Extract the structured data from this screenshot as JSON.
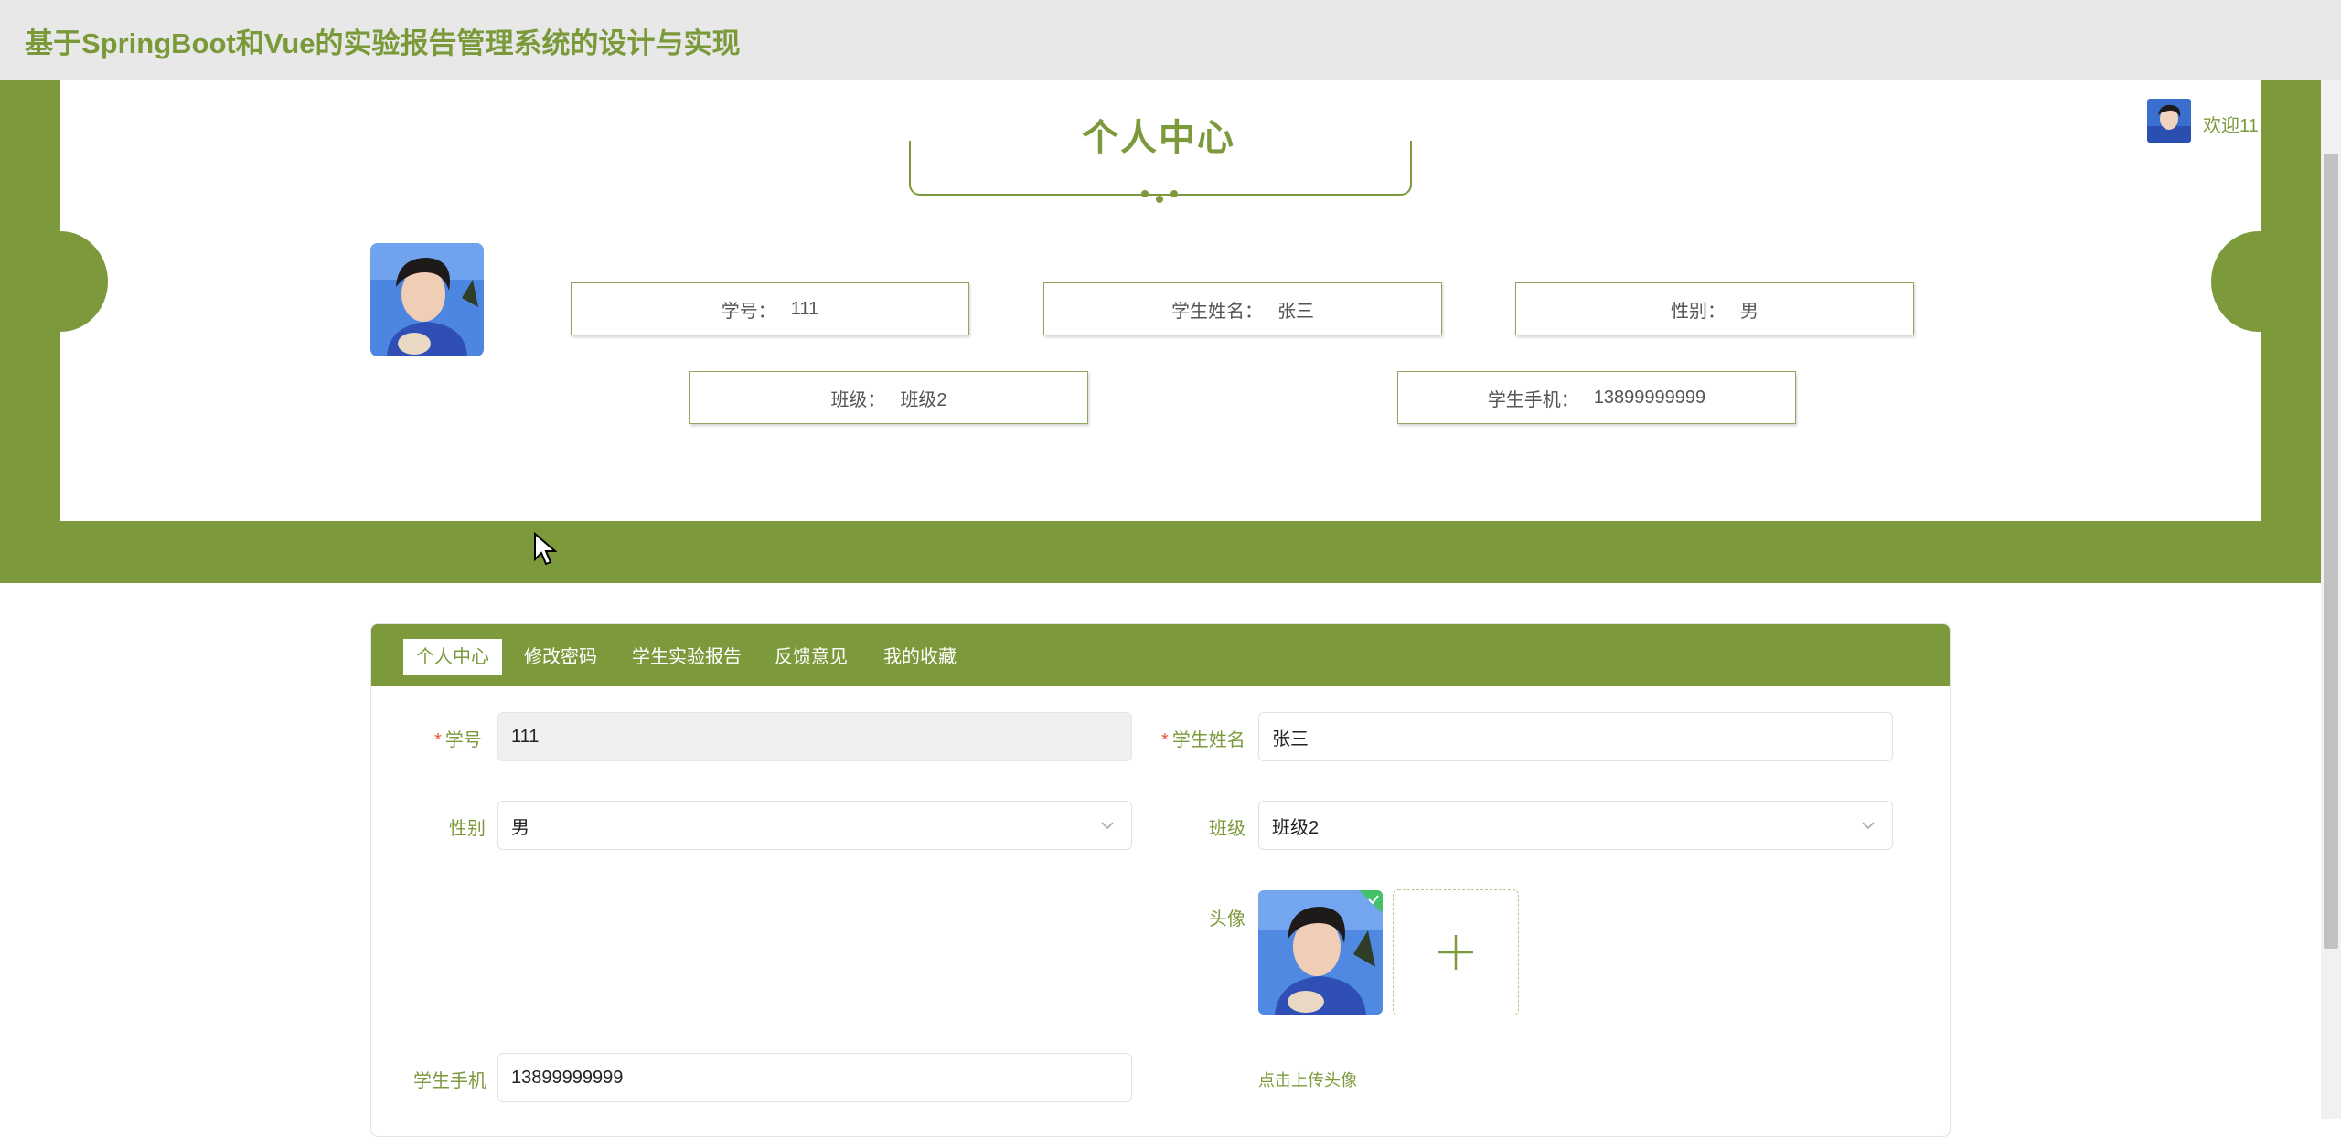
{
  "header": {
    "title": "基于SpringBoot和Vue的实验报告管理系统的设计与实现"
  },
  "user": {
    "welcome": "欢迎11"
  },
  "profile": {
    "heading": "个人中心",
    "fields": [
      {
        "label": "学号：",
        "value": "111"
      },
      {
        "label": "学生姓名：",
        "value": "张三"
      },
      {
        "label": "性别：",
        "value": "男"
      },
      {
        "label": "班级：",
        "value": "班级2"
      },
      {
        "label": "学生手机：",
        "value": "13899999999"
      }
    ]
  },
  "tabs": [
    "个人中心",
    "修改密码",
    "学生实验报告",
    "反馈意见",
    "我的收藏"
  ],
  "form": {
    "student_no": {
      "label": "学号",
      "value": "111",
      "required": true
    },
    "name": {
      "label": "学生姓名",
      "value": "张三",
      "required": true
    },
    "gender": {
      "label": "性别",
      "value": "男"
    },
    "class": {
      "label": "班级",
      "value": "班级2"
    },
    "avatar": {
      "label": "头像",
      "hint": "点击上传头像"
    },
    "phone": {
      "label": "学生手机",
      "value": "13899999999"
    }
  },
  "colors": {
    "accent": "#7c9a3c",
    "header_bg": "#e8e8e8",
    "success": "#43c06a"
  }
}
